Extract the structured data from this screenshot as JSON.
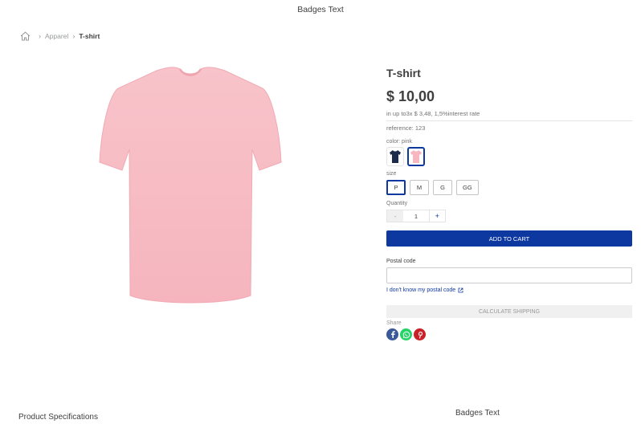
{
  "top_badge": "Badges Text",
  "breadcrumb": {
    "home_icon": "home-icon",
    "items": [
      "Apparel",
      "T-shirt"
    ]
  },
  "product": {
    "title": "T-shirt",
    "price": "$ 10,00",
    "installments": "in up to3x $ 3,48, 1,5%interest rate",
    "reference": "reference: 123",
    "color_label": "color: pink",
    "colors": [
      {
        "name": "navy",
        "hex": "#1c2b4a"
      },
      {
        "name": "pink",
        "hex": "#f6b7c0"
      }
    ],
    "selected_color": "pink",
    "size_label": "size",
    "sizes": [
      "P",
      "M",
      "G",
      "GG"
    ],
    "selected_size": "P",
    "quantity_label": "Quantity",
    "quantity": "1",
    "minus_label": "-",
    "plus_label": "+",
    "add_to_cart": "ADD TO CART",
    "image_color": "#f7bcc4"
  },
  "shipping": {
    "postal_label": "Postal code",
    "postal_placeholder": "",
    "postal_link": "I don't know my postal code",
    "calculate": "CALCULATE SHIPPING"
  },
  "share": {
    "label": "Share",
    "networks": [
      {
        "name": "facebook",
        "glyph": "f",
        "color": "#3b5998"
      },
      {
        "name": "whatsapp",
        "glyph": "w",
        "color": "#25d366"
      },
      {
        "name": "pinterest",
        "glyph": "p",
        "color": "#cb2027"
      }
    ]
  },
  "specs_title": "Product Specifications",
  "bottom_badge": "Badges Text",
  "colors": {
    "accent": "#0c389f",
    "text": "#3f3f40",
    "muted": "#727273"
  }
}
